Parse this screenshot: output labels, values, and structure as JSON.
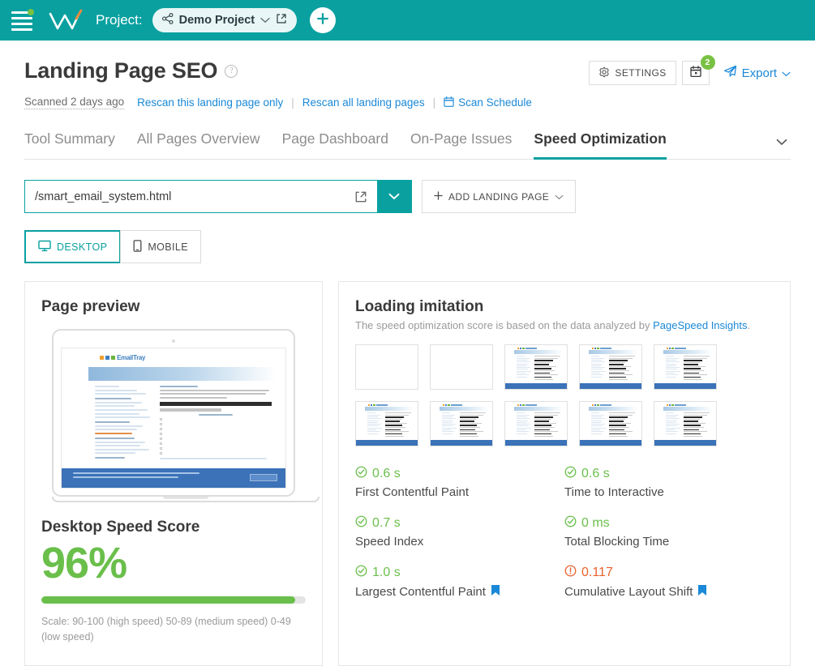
{
  "topbar": {
    "menu_icon": "hamburger-menu-icon",
    "notification_dot": "green-dot-indicator",
    "logo_icon": "w-logo-icon",
    "project_label": "Project:",
    "project_name": "Demo Project",
    "project_share_icon": "share-nodes-icon",
    "project_chevron_icon": "chevron-down-icon",
    "project_external_icon": "external-link-icon",
    "add_button_icon": "plus-icon",
    "accent_color": "#0aa0a0"
  },
  "header": {
    "title": "Landing Page SEO",
    "help_icon": "question-mark-circle-icon",
    "settings_label": "SETTINGS",
    "settings_icon": "gear-icon",
    "calendar_icon": "calendar-icon",
    "calendar_badge": "2",
    "export_label": "Export",
    "export_icon": "paper-plane-icon",
    "export_chevron_icon": "chevron-down-icon"
  },
  "subline": {
    "scanned": "Scanned 2 days ago",
    "rescan_page": "Rescan this landing page only",
    "rescan_all": "Rescan all landing pages",
    "separator": "|",
    "scan_schedule": "Scan Schedule",
    "scan_schedule_icon": "calendar-icon"
  },
  "tabs": {
    "items": [
      {
        "label": "Tool Summary",
        "active": false
      },
      {
        "label": "All Pages Overview",
        "active": false
      },
      {
        "label": "Page Dashboard",
        "active": false
      },
      {
        "label": "On-Page Issues",
        "active": false
      },
      {
        "label": "Speed Optimization",
        "active": true
      }
    ],
    "overflow_icon": "chevron-down-icon"
  },
  "url_row": {
    "value": "/smart_email_system.html",
    "placeholder": "/smart_email_system.html",
    "external_icon": "external-link-icon",
    "dropdown_icon": "chevron-down-icon",
    "add_landing_page_label": "ADD LANDING PAGE",
    "add_plus_icon": "plus-icon",
    "add_chevron_icon": "chevron-down-icon"
  },
  "device_toggle": {
    "desktop_label": "DESKTOP",
    "desktop_icon": "desktop-monitor-icon",
    "mobile_label": "MOBILE",
    "mobile_icon": "mobile-phone-icon",
    "active": "DESKTOP"
  },
  "page_preview": {
    "title": "Page preview",
    "device_mock": "laptop-mockup"
  },
  "speed_score": {
    "title": "Desktop Speed Score",
    "value": "96%",
    "percent": 96,
    "color": "#6abf4b",
    "scale_text": "Scale: 90-100 (high speed) 50-89 (medium speed) 0-49 (low speed)"
  },
  "loading_imitation": {
    "title": "Loading imitation",
    "subtitle_prefix": "The speed optimization score is based on the data analyzed by ",
    "subtitle_link": "PageSpeed Insights",
    "subtitle_suffix": ".",
    "frames": [
      {
        "blank": true
      },
      {
        "blank": true
      },
      {
        "blank": false
      },
      {
        "blank": false
      },
      {
        "blank": false
      },
      {
        "blank": false
      },
      {
        "blank": false
      },
      {
        "blank": false
      },
      {
        "blank": false
      },
      {
        "blank": false
      }
    ]
  },
  "metrics": {
    "left": [
      {
        "value": "0.6 s",
        "label": "First Contentful Paint",
        "status": "ok",
        "icon": "check-circle-icon",
        "flag": false
      },
      {
        "value": "0.7 s",
        "label": "Speed Index",
        "status": "ok",
        "icon": "check-circle-icon",
        "flag": false
      },
      {
        "value": "1.0 s",
        "label": "Largest Contentful Paint",
        "status": "ok",
        "icon": "check-circle-icon",
        "flag": true
      }
    ],
    "right": [
      {
        "value": "0.6 s",
        "label": "Time to Interactive",
        "status": "ok",
        "icon": "check-circle-icon",
        "flag": false
      },
      {
        "value": "0 ms",
        "label": "Total Blocking Time",
        "status": "ok",
        "icon": "check-circle-icon",
        "flag": false
      },
      {
        "value": "0.117",
        "label": "Cumulative Layout Shift",
        "status": "warn",
        "icon": "exclamation-circle-icon",
        "flag": true
      }
    ],
    "ok_color": "#6abf4b",
    "warn_color": "#e8622d",
    "flag_color": "#1a88d8",
    "flag_icon": "bookmark-flag-icon"
  }
}
